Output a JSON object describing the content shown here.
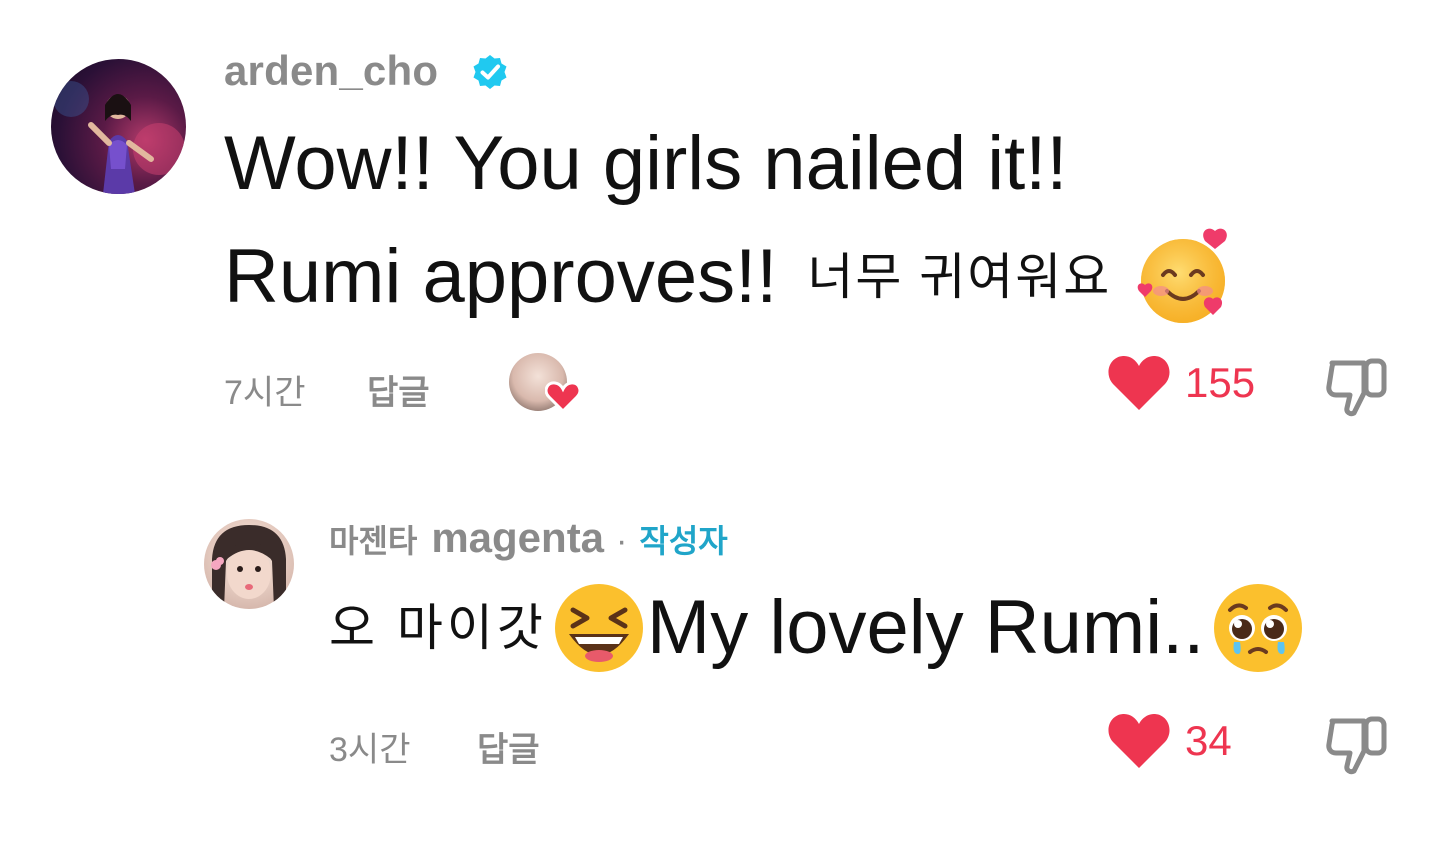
{
  "comments": [
    {
      "username": "arden_cho",
      "verified": true,
      "text_line1": "Wow!! You girls nailed it!!",
      "text_line2_en": "Rumi approves!!",
      "text_line2_ko": "너무 귀여워요",
      "text_emoji": "smiling-face-with-hearts",
      "time": "7시간",
      "reply_label": "답글",
      "creator_liked": true,
      "likes": "155",
      "liked": true
    }
  ],
  "replies": [
    {
      "username_ko": "마젠타",
      "username_en": "magenta",
      "separator": "·",
      "author_badge": "작성자",
      "text_ko": "오 마이갓",
      "text_emoji_1": "grinning-squinting-face",
      "text_en": "My lovely Rumi..",
      "text_emoji_2": "pleading-face",
      "time": "3시간",
      "reply_label": "답글",
      "likes": "34",
      "liked": true
    }
  ],
  "colors": {
    "username_gray": "#8a8a8a",
    "text": "#111111",
    "like_red": "#ee3550",
    "author_badge_blue": "#20a5c9",
    "verified_blue": "#20c9f0"
  }
}
